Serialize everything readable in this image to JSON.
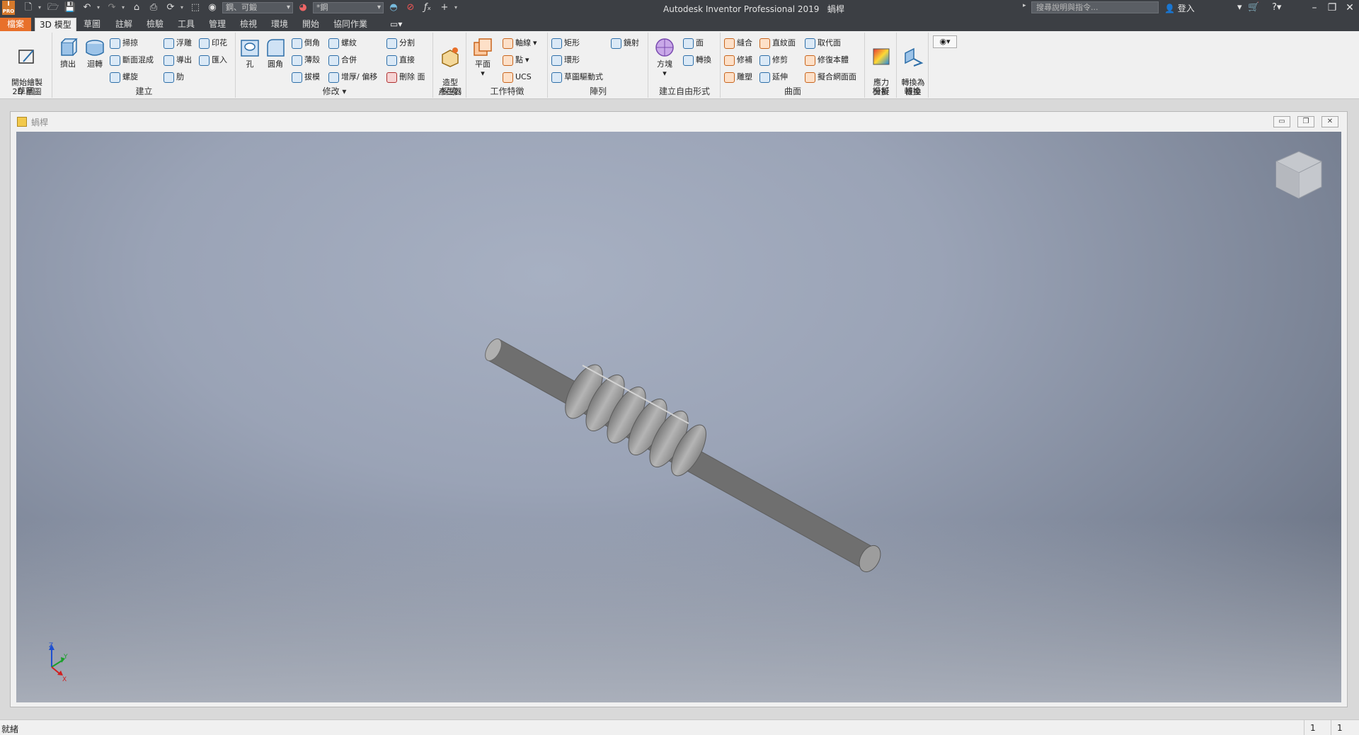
{
  "app": {
    "title": "Autodesk Inventor Professional 2019",
    "document_name": "蝸桿",
    "logo_text": "I\nPRO",
    "material_combo": "鋼、可鍛",
    "appearance_combo": "*鋼",
    "search_placeholder": "搜尋說明與指令...",
    "login_label": "登入"
  },
  "tabs": [
    {
      "label": "檔案"
    },
    {
      "label": "3D 模型"
    },
    {
      "label": "草圖"
    },
    {
      "label": "註解"
    },
    {
      "label": "檢驗"
    },
    {
      "label": "工具"
    },
    {
      "label": "管理"
    },
    {
      "label": "檢視"
    },
    {
      "label": "環境"
    },
    {
      "label": "開始"
    },
    {
      "label": "協同作業"
    }
  ],
  "ribbon": {
    "panels": {
      "sketch": {
        "title": "草圖",
        "start_2d": "開始繪製\n2D 草圖"
      },
      "create": {
        "title": "建立",
        "extrude": "擠出",
        "revolve": "迴轉",
        "sweep": "掃掠",
        "loft": "斷面混成",
        "coil": "螺旋",
        "emboss": "浮雕",
        "derive": "導出",
        "rib": "肋",
        "decal": "印花",
        "import": "匯入"
      },
      "modify": {
        "title": "修改",
        "hole": "孔",
        "fillet": "圓角",
        "chamfer": "倒角",
        "shell": "薄殼",
        "draft": "拔模",
        "thread": "螺紋",
        "combine": "合併",
        "thicken": "增厚/ 偏移",
        "split": "分割",
        "direct": "直接",
        "delete_face": "刪除 面"
      },
      "explore": {
        "title": "探索",
        "shape_generator": "造型\n產生器"
      },
      "work_features": {
        "title": "工作特徵",
        "plane": "平面",
        "axis": "軸線",
        "point": "點",
        "ucs": "UCS"
      },
      "pattern": {
        "title": "陣列",
        "rectangular": "矩形",
        "circular": "環形",
        "sketch_driven": "草圖驅動式",
        "mirror": "鏡射"
      },
      "freeform": {
        "title": "建立自由形式",
        "box": "方塊",
        "face": "面",
        "convert": "轉換"
      },
      "surface": {
        "title": "曲面",
        "stitch": "縫合",
        "patch": "修補",
        "sculpt": "雕塑",
        "ruled": "直紋面",
        "trim": "修剪",
        "extend": "延伸",
        "replace_face": "取代面",
        "repair_bodies": "修復本體",
        "fit_mesh": "擬合網面面"
      },
      "simulation": {
        "title": "模擬",
        "stress": "應力\n分析"
      },
      "convert": {
        "title": "轉換",
        "sheet_metal": "轉換為\n板金"
      }
    }
  },
  "status": {
    "text": "就緒",
    "cell1": "1",
    "cell2": "1"
  },
  "triad": {
    "z": "Z",
    "y": "Y",
    "x": "X"
  },
  "colors": {
    "accent_orange": "#e8702a",
    "titlebar": "#3c3f44",
    "model_gray": "#9a9a9a"
  }
}
